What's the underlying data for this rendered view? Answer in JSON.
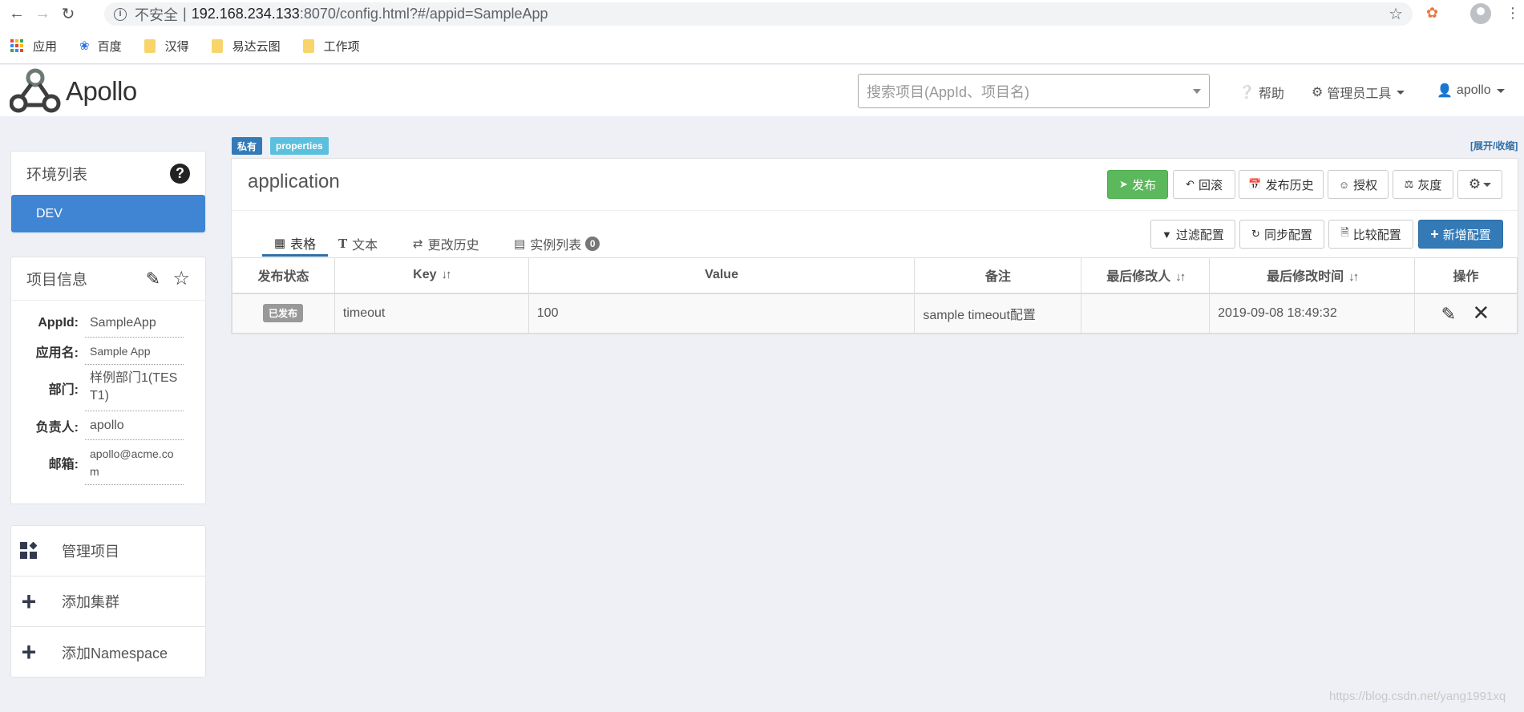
{
  "browser": {
    "insecure_label": "不安全",
    "url_host": "192.168.234.133",
    "url_rest": ":8070/config.html?#/appid=SampleApp",
    "bookmarks": [
      "应用",
      "百度",
      "汉得",
      "易达云图",
      "工作项"
    ]
  },
  "header": {
    "logo_text": "Apollo",
    "search_placeholder": "搜索项目(AppId、项目名)",
    "help": "帮助",
    "admin_tools": "管理员工具",
    "user": "apollo"
  },
  "sidebar": {
    "env_title": "环境列表",
    "envs": [
      "DEV"
    ],
    "project_title": "项目信息",
    "info": [
      {
        "label": "AppId:",
        "value": "SampleApp"
      },
      {
        "label": "应用名:",
        "value": "Sample App"
      },
      {
        "label": "部门:",
        "value": "样例部门1(TEST1)"
      },
      {
        "label": "负责人:",
        "value": "apollo"
      },
      {
        "label": "邮箱:",
        "value": "apollo@acme.com"
      }
    ],
    "actions": [
      "管理项目",
      "添加集群",
      "添加Namespace"
    ]
  },
  "namespace": {
    "tag_private": "私有",
    "tag_format": "properties",
    "expand_toggle": "[展开/收缩]",
    "title": "application",
    "buttons": {
      "publish": "发布",
      "rollback": "回滚",
      "history": "发布历史",
      "grant": "授权",
      "gray": "灰度"
    },
    "tabs": [
      "表格",
      "文本",
      "更改历史",
      "实例列表"
    ],
    "instance_count": "0",
    "tools": {
      "filter": "过滤配置",
      "sync": "同步配置",
      "diff": "比较配置",
      "add": "新增配置"
    },
    "table": {
      "headers": [
        "发布状态",
        "Key",
        "Value",
        "备注",
        "最后修改人",
        "最后修改时间",
        "操作"
      ],
      "rows": [
        {
          "status": "已发布",
          "key": "timeout",
          "value": "100",
          "comment": "sample timeout配置",
          "modifier": "",
          "time": "2019-09-08 18:49:32"
        }
      ]
    }
  },
  "watermark": "https://blog.csdn.net/yang1991xq",
  "colors": {
    "primary": "#337ab7",
    "success": "#5cb85c",
    "env_active": "#3f85d3",
    "tag_info": "#5bc0de"
  }
}
